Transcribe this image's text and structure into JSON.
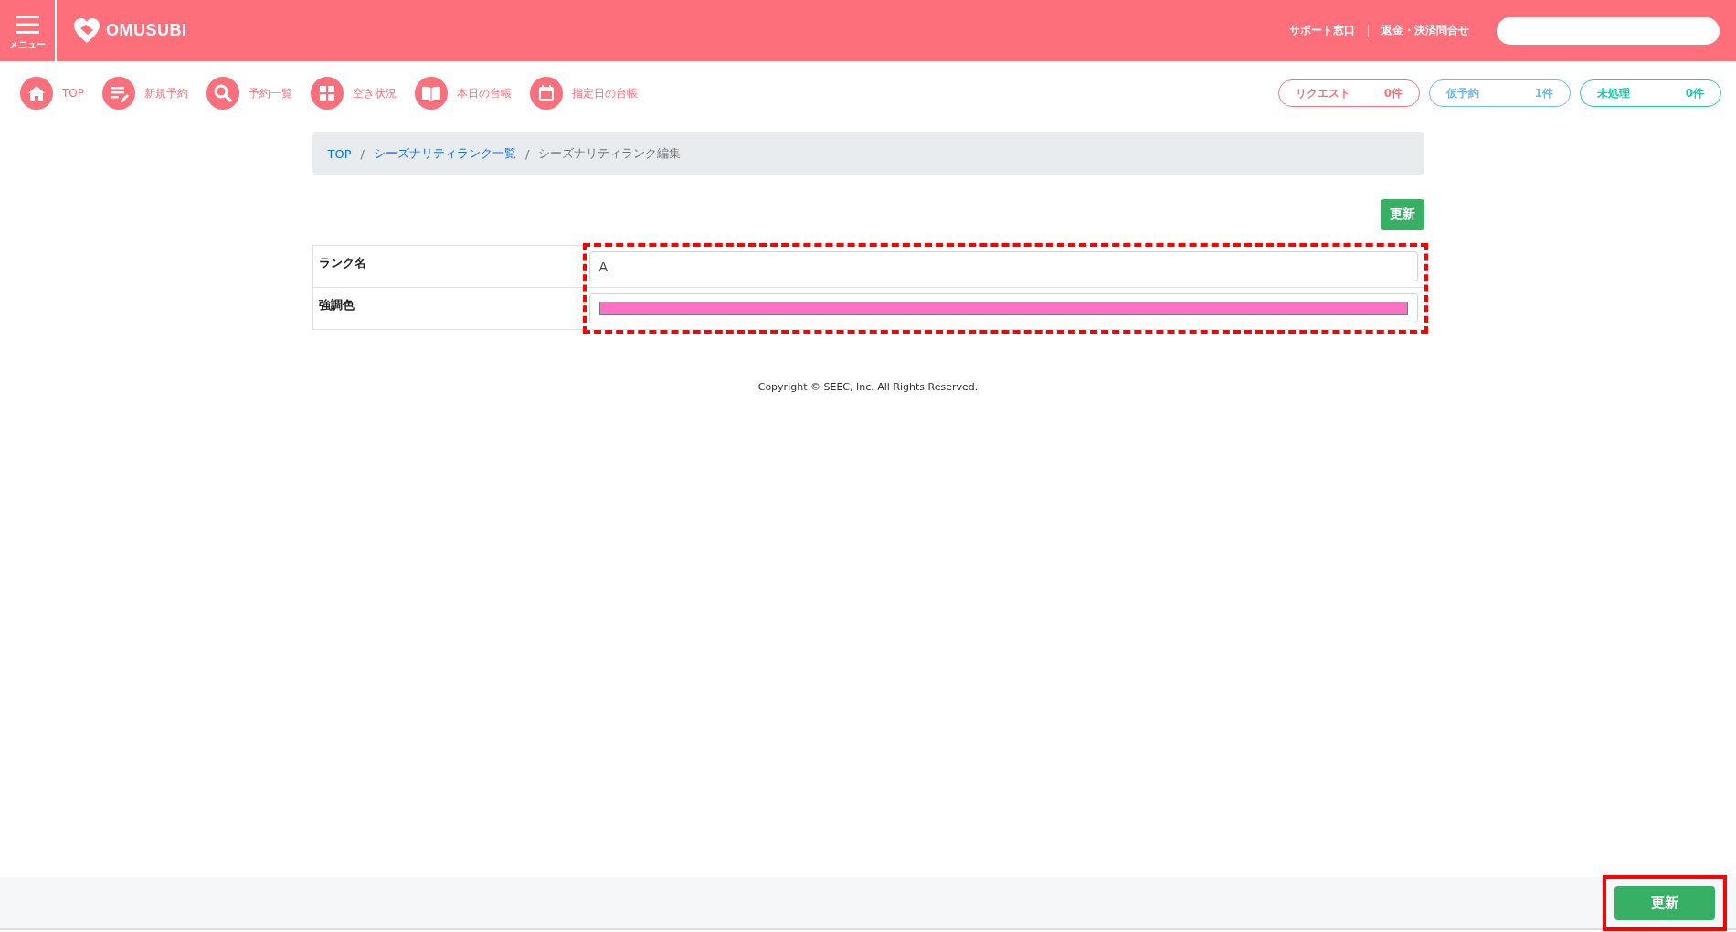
{
  "header": {
    "menu_label": "メニュー",
    "logo": "OMUSUBI",
    "links": [
      "サポート窓口",
      "返金・決済問合せ"
    ]
  },
  "nav": [
    {
      "kind": "home",
      "label": "TOP"
    },
    {
      "kind": "edit",
      "label": "新規予約"
    },
    {
      "kind": "search",
      "label": "予約一覧"
    },
    {
      "kind": "grid",
      "label": "空き状況"
    },
    {
      "kind": "book",
      "label": "本日の台帳"
    },
    {
      "kind": "calendar",
      "label": "指定日の台帳"
    }
  ],
  "status": [
    {
      "label": "リクエスト",
      "count": "0件",
      "color": "#f5737e"
    },
    {
      "label": "仮予約",
      "count": "1件",
      "color": "#6cb8f5"
    },
    {
      "label": "未処理",
      "count": "0件",
      "color": "#1ec9a7"
    }
  ],
  "breadcrumb_separator": "/",
  "breadcrumb": [
    {
      "label": "TOP",
      "link": true
    },
    {
      "label": "シーズナリティランク一覧",
      "link": true
    },
    {
      "label": "シーズナリティランク編集",
      "link": false
    }
  ],
  "update_button": "更新",
  "form": {
    "highlighted": true,
    "rows": [
      {
        "kind": "text",
        "label": "ランク名",
        "value": "A"
      },
      {
        "kind": "color",
        "label": "強調色",
        "color": "#ff6fc6"
      }
    ]
  },
  "copyright": "Copyright © SEEC, Inc. All Rights Reserved.",
  "footer": {
    "button": "更新",
    "highlighted": true
  }
}
